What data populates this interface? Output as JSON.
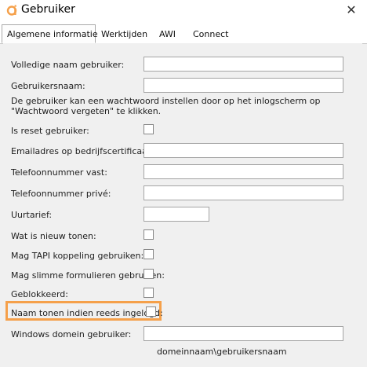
{
  "window": {
    "title": "Gebruiker",
    "close_symbol": "✕",
    "icon": "app-logo-icon",
    "accent_color": "#f5a04a"
  },
  "tabs": [
    {
      "label": "Algemene informatie",
      "active": true
    },
    {
      "label": "Werktijden",
      "active": false
    },
    {
      "label": "AWI",
      "active": false
    },
    {
      "label": "Connect",
      "active": false
    }
  ],
  "form": {
    "full_name": {
      "label": "Volledige naam gebruiker:",
      "value": ""
    },
    "username": {
      "label": "Gebruikersnaam:",
      "value": ""
    },
    "password_info": "De gebruiker kan een wachtwoord instellen door op het inlogscherm op \"Wachtwoord vergeten\" te klikken.",
    "is_reset": {
      "label": "Is reset gebruiker:",
      "checked": false
    },
    "company_cert_email": {
      "label": "Emailadres op bedrijfscertificaat:",
      "value": ""
    },
    "phone_fixed": {
      "label": "Telefoonnummer vast:",
      "value": ""
    },
    "phone_private": {
      "label": "Telefoonnummer privé:",
      "value": ""
    },
    "hourly_rate": {
      "label": "Uurtarief:",
      "value": ""
    },
    "show_whats_new": {
      "label": "Wat is nieuw tonen:",
      "checked": false
    },
    "tapi_coupling": {
      "label": "Mag TAPI koppeling gebruiken:",
      "checked": false
    },
    "smart_forms": {
      "label": "Mag slimme formulieren gebruiken:",
      "checked": false
    },
    "blocked": {
      "label": "Geblokkeerd:",
      "checked": false
    },
    "show_name_logged_in": {
      "label": "Naam tonen indien reeds ingelogd:",
      "checked": false,
      "highlighted": true
    },
    "windows_domain_user": {
      "label": "Windows domein gebruiker:",
      "value": "",
      "hint": "domeinnaam\\gebruikersnaam"
    }
  }
}
